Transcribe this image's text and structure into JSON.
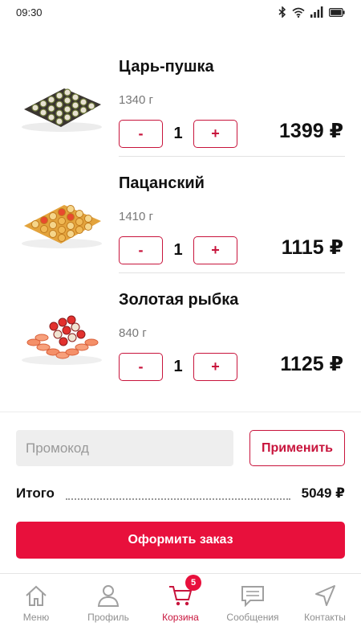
{
  "status_bar": {
    "time": "09:30",
    "icons": [
      "bluetooth-icon",
      "wifi-icon",
      "signal-icon",
      "battery-icon"
    ]
  },
  "cart": {
    "items": [
      {
        "name": "Царь-пушка",
        "weight": "1340 г",
        "quantity": "1",
        "price": "1399 ₽",
        "minus": "-",
        "plus": "+"
      },
      {
        "name": "Пацанский",
        "weight": "1410 г",
        "quantity": "1",
        "price": "1115 ₽",
        "minus": "-",
        "plus": "+"
      },
      {
        "name": "Золотая рыбка",
        "weight": "840 г",
        "quantity": "1",
        "price": "1125 ₽",
        "minus": "-",
        "plus": "+"
      }
    ]
  },
  "promo": {
    "placeholder": "Промокод",
    "apply_label": "Применить"
  },
  "total": {
    "label": "Итого",
    "value": "5049 ₽"
  },
  "checkout": {
    "label": "Оформить заказ"
  },
  "nav": {
    "items": [
      {
        "label": "Меню",
        "icon": "home-icon"
      },
      {
        "label": "Профиль",
        "icon": "user-icon"
      },
      {
        "label": "Корзина",
        "icon": "cart-icon",
        "badge": "5",
        "active": true
      },
      {
        "label": "Сообщения",
        "icon": "chat-icon"
      },
      {
        "label": "Контакты",
        "icon": "navigation-arrow-icon"
      }
    ]
  },
  "colors": {
    "accent": "#e8103c",
    "accent_outline": "#c8143c"
  }
}
